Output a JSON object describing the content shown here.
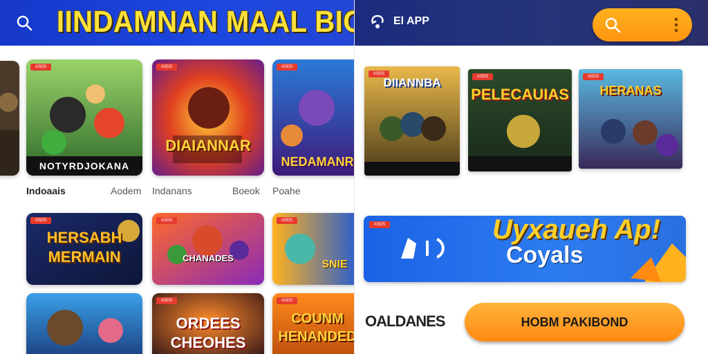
{
  "left_panel": {
    "title": "IINDAMNAN MAAL BIOAR",
    "categories": [
      "Indoaais",
      "Aodem",
      "Indanans",
      "Boeok",
      "Poahe"
    ],
    "tiles": [
      {
        "label": "",
        "badge": "ASDS"
      },
      {
        "label": "NOTYRDJOKANA",
        "badge": "ASDS"
      },
      {
        "label": "DIAIANNAR",
        "badge": "ASDS"
      },
      {
        "label": "NEDAMANR",
        "badge": "ASDS"
      },
      {
        "label": "",
        "badge": ""
      },
      {
        "label": "HERSABH MERMAIN",
        "badge": "ASDS"
      },
      {
        "label": "CHANADES",
        "badge": "ASDS"
      },
      {
        "label": "SNIE",
        "badge": "ASDS"
      },
      {
        "label": "",
        "badge": ""
      },
      {
        "label": "ORDEES CHEOHES",
        "badge": "ASDS"
      },
      {
        "label": "COUNM HENANDED",
        "badge": "ASDS"
      }
    ]
  },
  "right_panel": {
    "app_name": "El APP",
    "featured": [
      {
        "label": "DIIANNBA",
        "badge": "ASDS"
      },
      {
        "label": "PELECAUIAS",
        "badge": "ASDS"
      },
      {
        "label": "HERANAS",
        "badge": "ASDS"
      }
    ],
    "promo": {
      "badge": "ASDS",
      "headline": "Uyxaueh Ap!",
      "subline": "Coyals"
    },
    "bottom_brand": "OALDANES",
    "cta_label": "HOBM PAKIBOND"
  },
  "colors": {
    "header_blue": "#1d47e0",
    "title_yellow": "#ffe23a",
    "accent_orange": "#ff9410",
    "badge_red": "#e63b2e"
  },
  "icons": {
    "left_search": "search-icon",
    "right_brand": "app-logo-icon",
    "right_search": "search-icon",
    "right_menu": "kebab-menu-icon"
  }
}
